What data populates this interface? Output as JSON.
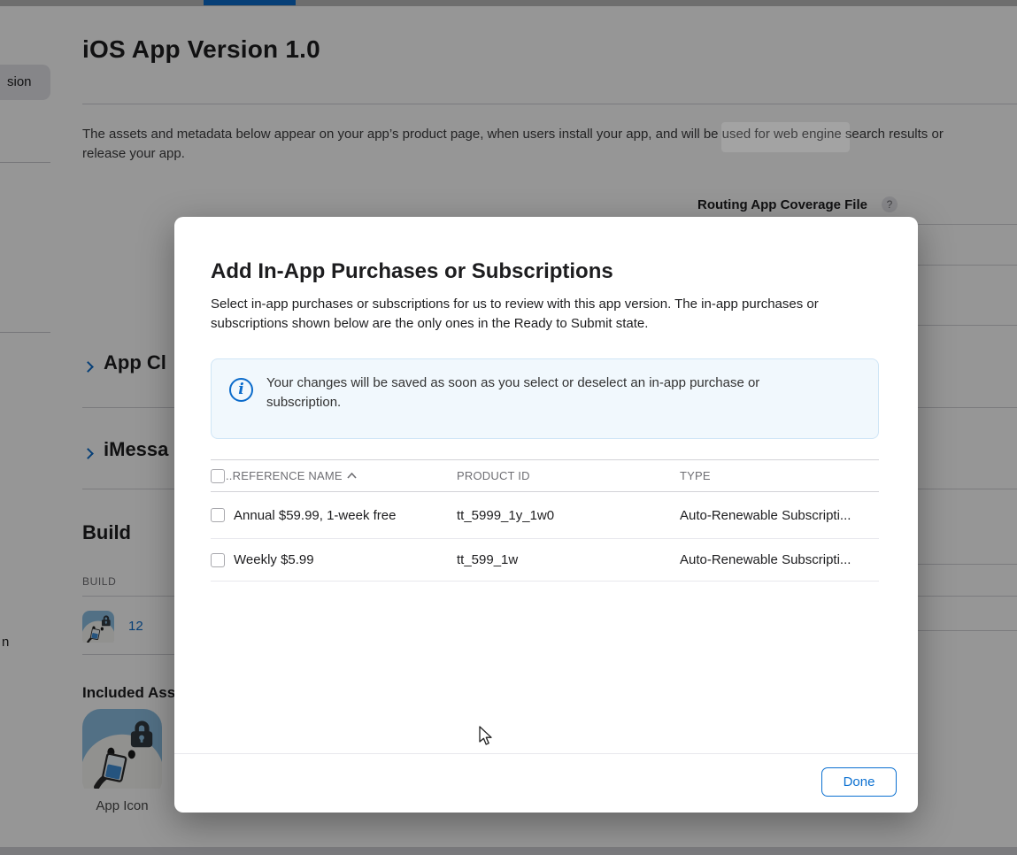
{
  "page": {
    "sidebar": {
      "selected_item_partial": "sion",
      "stray_text_partial": "n"
    },
    "title": "iOS App Version 1.0",
    "intro_line1": "The assets and metadata below appear on your app’s product page, when users install your app, and will be used for web engine search results or",
    "intro_line2": "release your app.",
    "routing": {
      "label": "Routing App Coverage File",
      "help_glyph": "?"
    },
    "sections": {
      "app_clip_partial": "App Cl",
      "imessage_partial": "iMessa"
    },
    "build": {
      "heading": "Build",
      "column_header": "BUILD",
      "build_number": "12",
      "included_assets_partial": "Included Asse",
      "app_icon_label": "App Icon"
    }
  },
  "modal": {
    "title": "Add In-App Purchases or Subscriptions",
    "subtitle": "Select in-app purchases or subscriptions for us to review with this app version. The in-app purchases or subscriptions shown below are the only ones in the Ready to Submit state.",
    "banner": {
      "icon": "info-circle-icon",
      "text": "Your changes will be saved as soon as you select or deselect an in-app purchase or subscription."
    },
    "table": {
      "headers": {
        "reference": "..REFERENCE NAME",
        "product": "PRODUCT ID",
        "type": "TYPE"
      },
      "sort": "ascending",
      "rows": [
        {
          "name": "Annual $59.99, 1-week free",
          "product_id": "tt_5999_1y_1w0",
          "type": "Auto-Renewable Subscripti...",
          "checked": false
        },
        {
          "name": "Weekly $5.99",
          "product_id": "tt_599_1w",
          "type": "Auto-Renewable Subscripti...",
          "checked": false
        }
      ]
    },
    "done_label": "Done"
  },
  "colors": {
    "accent_blue": "#0b6bcb",
    "done_blue": "#0b70d1",
    "banner_bg": "#f1f8fd",
    "banner_border": "#cfe5f6",
    "overlay": "rgba(0,0,0,0.41)",
    "header_text_gray": "#6e6e73"
  }
}
